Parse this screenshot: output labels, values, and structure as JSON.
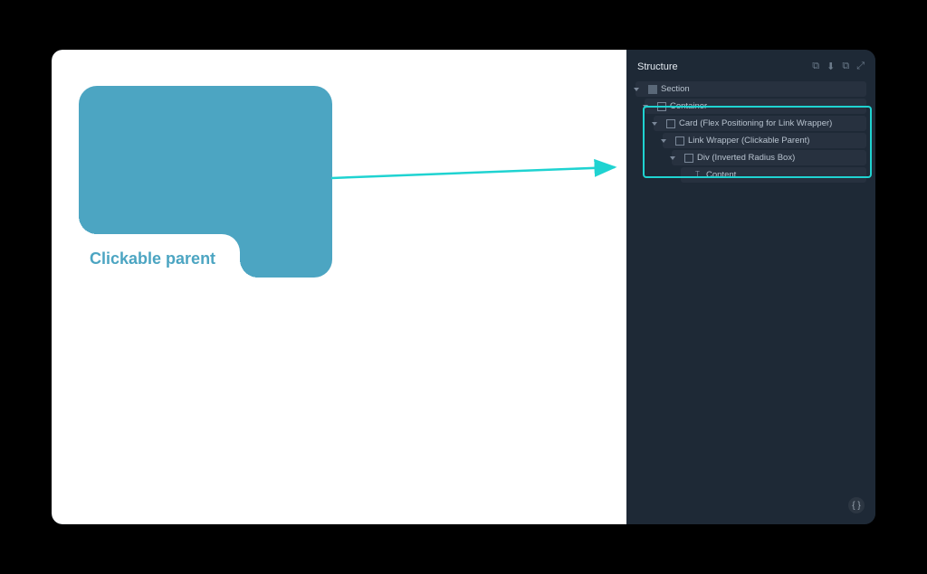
{
  "panel": {
    "title": "Structure",
    "actions": {
      "copy": "⧉",
      "download": "⬇",
      "duplicate": "⧉",
      "expand": "⤢"
    }
  },
  "tree": {
    "items": [
      {
        "label": "Section",
        "icon": "section-icon",
        "level": 0,
        "has_children": true
      },
      {
        "label": "Container",
        "icon": "box-icon",
        "level": 1,
        "has_children": true
      },
      {
        "label": "Card (Flex Positioning for Link Wrapper)",
        "icon": "box-icon",
        "level": 2,
        "has_children": true
      },
      {
        "label": "Link Wrapper (Clickable Parent)",
        "icon": "box-icon",
        "level": 3,
        "has_children": true
      },
      {
        "label": "Div (Inverted Radius Box)",
        "icon": "box-icon",
        "level": 4,
        "has_children": true
      },
      {
        "label": "Content",
        "icon": "text-icon",
        "level": 5,
        "has_children": false
      }
    ]
  },
  "card": {
    "label": "Clickable parent"
  },
  "colors": {
    "card_bg": "#4ca5c2",
    "highlight": "#1fd3d1",
    "panel_bg": "#1e2936"
  },
  "bottom_badge": "{ }"
}
